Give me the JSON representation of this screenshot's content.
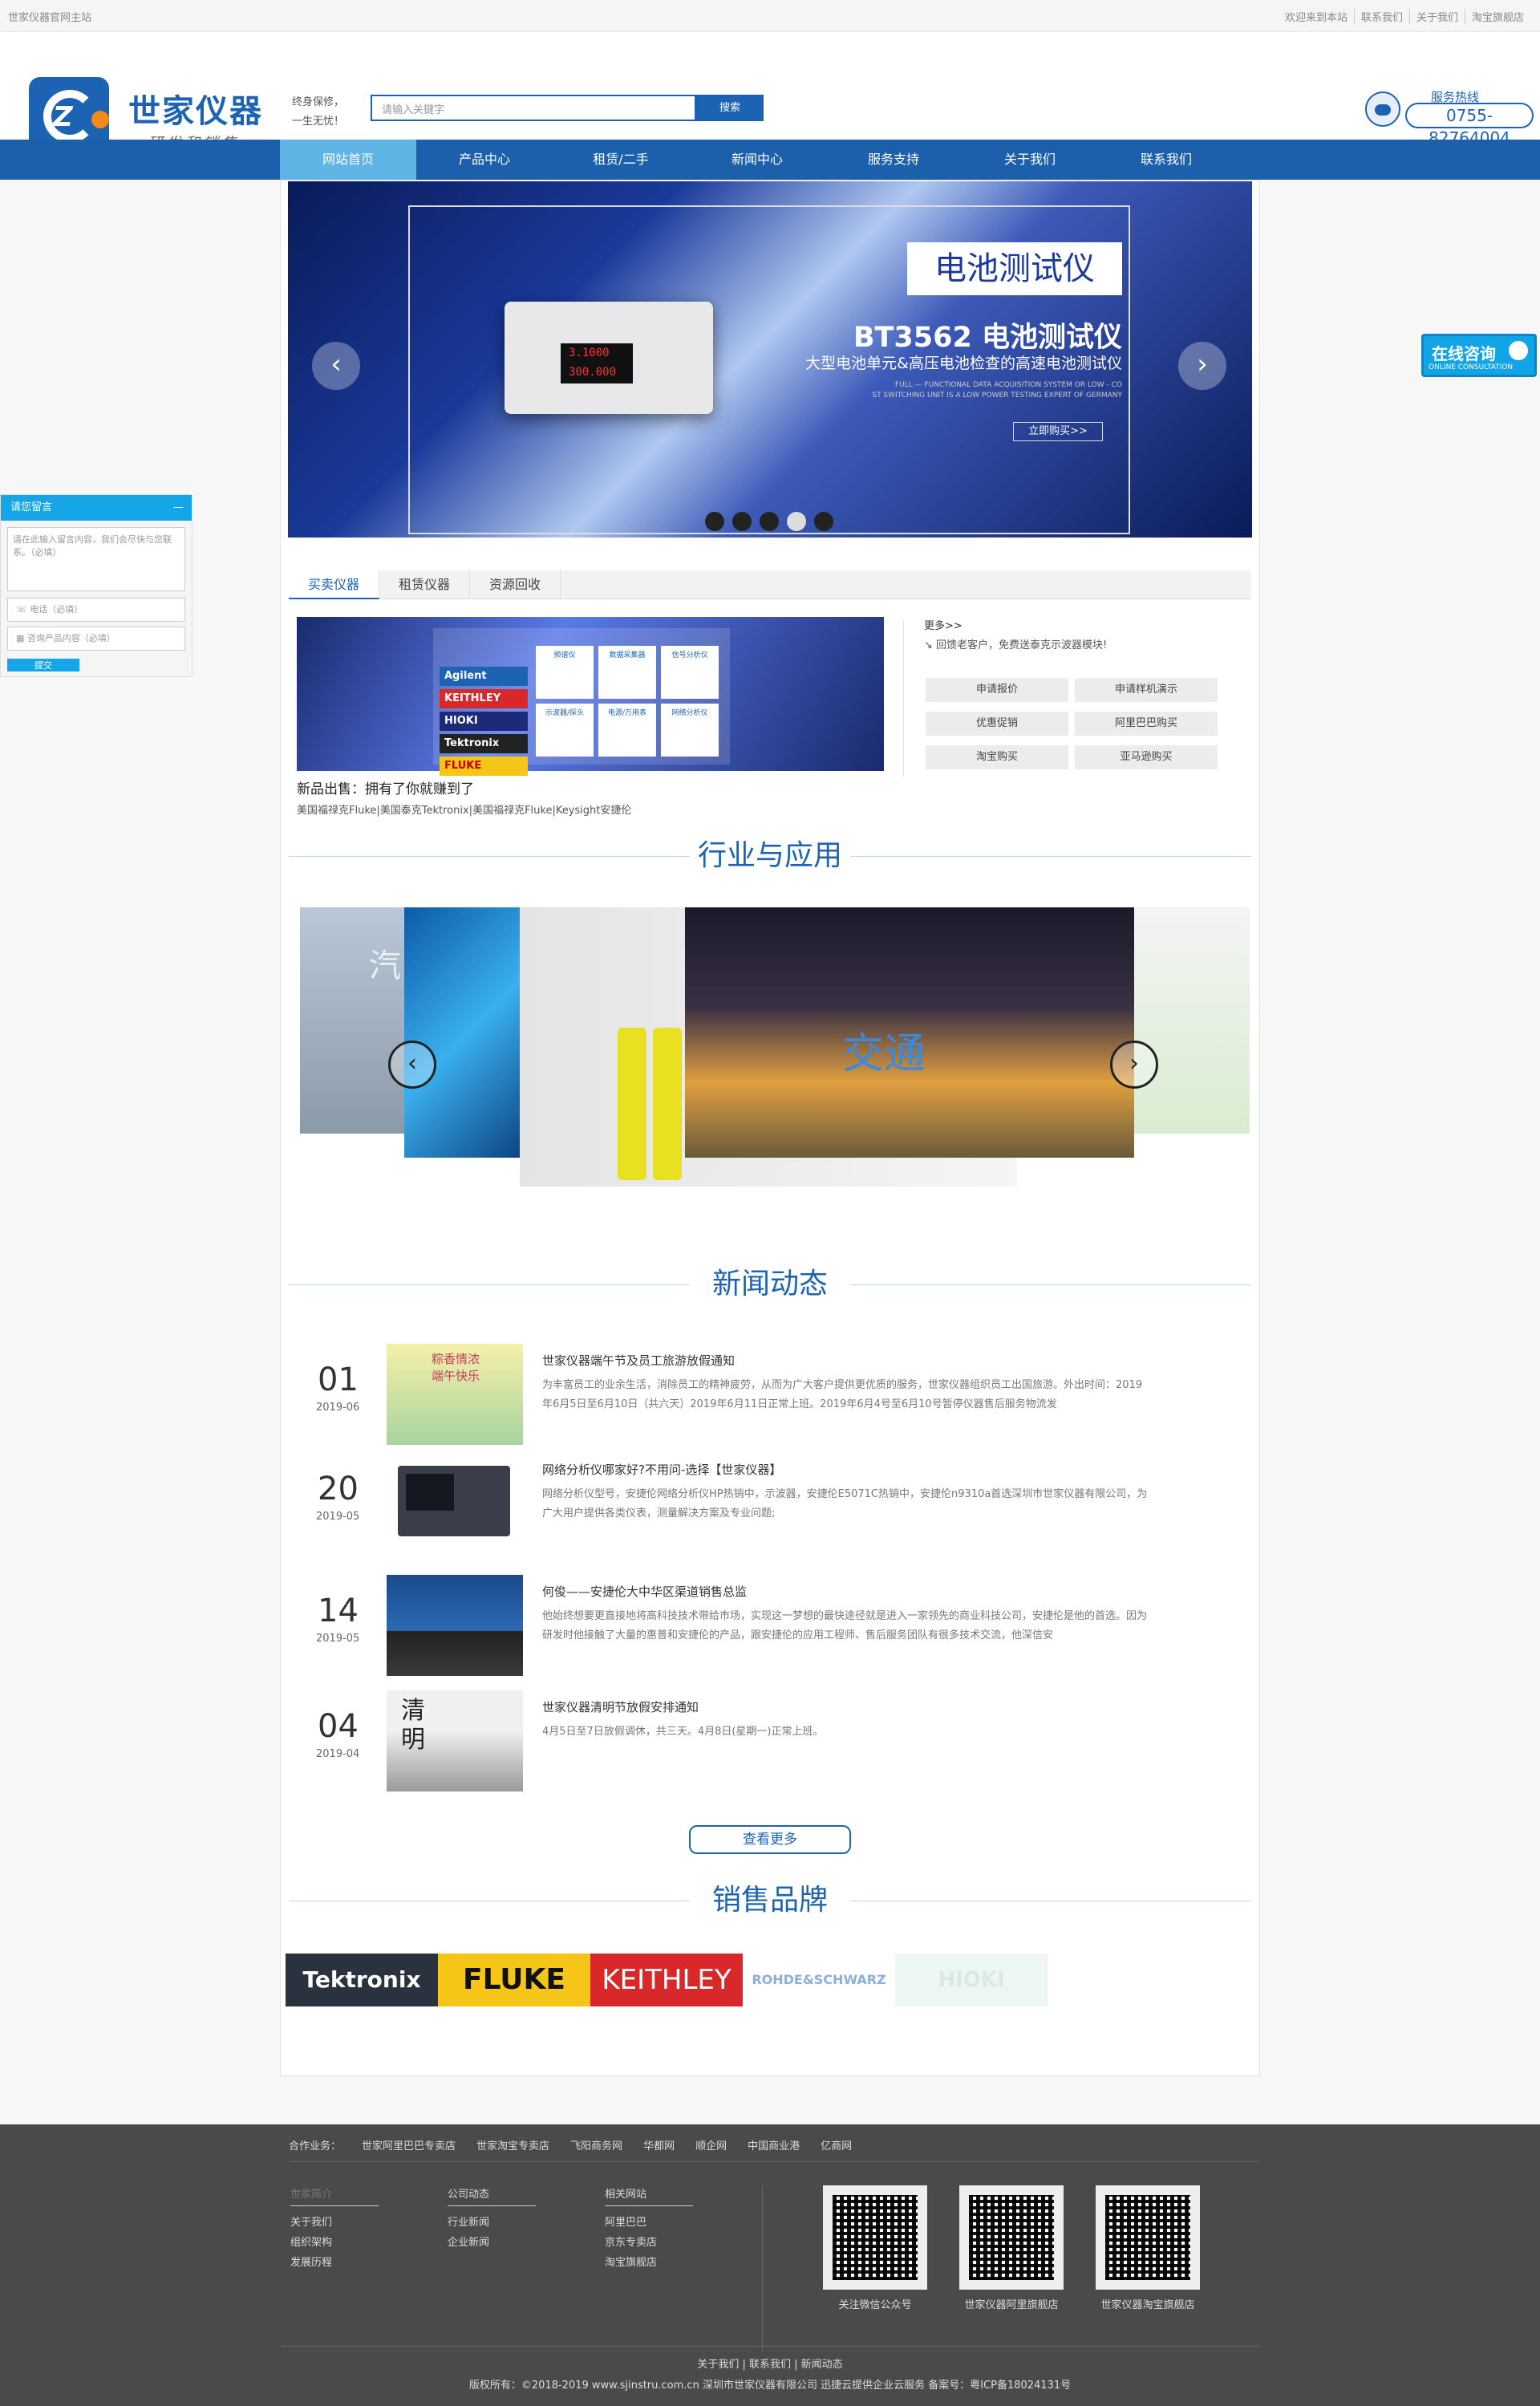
{
  "topbar": {
    "left": "世家仪器官网主站",
    "links": [
      "欢迎来到本站",
      "联系我们",
      "关于我们",
      "淘宝旗舰店"
    ]
  },
  "header": {
    "brand_name": "世家仪器",
    "brand_slogan": "研发和销售",
    "tagline_1": "终身保修，",
    "tagline_2": "一生无忧！",
    "search_placeholder": "请输入关键字",
    "search_button": "搜索",
    "hotline_label": "服务热线",
    "hotline_number": "0755-82764004"
  },
  "nav": [
    "网站首页",
    "产品中心",
    "租赁/二手",
    "新闻中心",
    "服务支持",
    "关于我们",
    "联系我们"
  ],
  "banner": {
    "title_box": "电池测试仪",
    "title": "BT3562 电池测试仪",
    "subtitle": "大型电池单元&高压电池检查的高速电池测试仪",
    "small_1": "FULL — FUNCTIONAL DATA ACQUISITION SYSTEM OR LOW - CO",
    "small_2": "ST SWITCHING UNIT IS A LOW POWER TESTING EXPERT OF GERMANY",
    "buy": "立即购买>>",
    "screen_1": "3.1000",
    "screen_2": "300.000",
    "slide_count": 5,
    "active_slide": 4
  },
  "tabs": [
    "买卖仪器",
    "租赁仪器",
    "资源回收"
  ],
  "product": {
    "brands": [
      "Agilent",
      "KEITHLEY",
      "HIOKI",
      "Tektronix",
      "FLUKE"
    ],
    "tiles": [
      "频谱仪",
      "数据采集器",
      "信号分析仪",
      "示波器/探头",
      "电源/万用表",
      "网络分析仪"
    ],
    "title": "新品出售：拥有了你就赚到了",
    "subtitle": "美国福禄克Fluke|美国泰克Tektronix|美国福禄克Fluke|Keysight安捷伦"
  },
  "side": {
    "more": "更多>>",
    "notice": "回馈老客户，免费送泰克示波器模块!",
    "buttons": [
      "申请报价",
      "申请样机演示",
      "优惠促销",
      "阿里巴巴购买",
      "淘宝购买",
      "亚马逊购买"
    ]
  },
  "sections": {
    "industry": "行业与应用",
    "news": "新闻动态",
    "brands": "销售品牌"
  },
  "carousel": {
    "left_label": "汽",
    "center_label": "交通"
  },
  "news": [
    {
      "day": "01",
      "month": "2019-06",
      "title": "世家仪器端午节及员工旅游放假通知",
      "body": "为丰富员工的业余生活，消除员工的精神疲劳，从而为广大客户提供更优质的服务，世家仪器组织员工出国旅游。外出时间：2019年6月5日至6月10日（共六天）2019年6月11日正常上班。2019年6月4号至6月10号暂停仪器售后服务物流发"
    },
    {
      "day": "20",
      "month": "2019-05",
      "title": "网络分析仪哪家好?不用问-选择【世家仪器】",
      "body": "网络分析仪型号，安捷伦网络分析仪HP热销中，示波器，安捷伦E5071C热销中，安捷伦n9310a首选深圳市世家仪器有限公司，为广大用户提供各类仪表，测量解决方案及专业问题;"
    },
    {
      "day": "14",
      "month": "2019-05",
      "title": "何俊——安捷伦大中华区渠道销售总监",
      "body": "他始终想要更直接地将高科技技术带给市场，实现这一梦想的最快途径就是进入一家领先的商业科技公司，安捷伦是他的首选。因为研发时他接触了大量的惠普和安捷伦的产品，跟安捷伦的应用工程师、售后服务团队有很多技术交流，他深信安"
    },
    {
      "day": "04",
      "month": "2019-04",
      "title": "世家仪器清明节放假安排通知",
      "body": "4月5日至7日放假调休，共三天。4月8日(星期一)正常上班。"
    }
  ],
  "news_thumb_text": [
    "粽香情浓 端午快乐",
    "清明"
  ],
  "view_more": "查看更多",
  "brand_logos": [
    "Tektronix",
    "FLUKE",
    "KEITHLEY",
    "ROHDE&SCHWARZ",
    "HIOKI"
  ],
  "left_panel": {
    "title": "请您留言",
    "min": "—",
    "message_placeholder": "请在此输入留言内容，我们会尽快与您联系。（必填）",
    "phone_placeholder": "电话（必填）",
    "product_placeholder": "咨询产品内容（必填）",
    "submit": "提交"
  },
  "consult": {
    "title": "在线咨询",
    "sub": "ONLINE CONSULTATION"
  },
  "footer": {
    "partner_label": "合作业务：",
    "partners": [
      "世家阿里巴巴专卖店",
      "世家淘宝专卖店",
      "飞阳商务网",
      "华都网",
      "顺企网",
      "中国商业港",
      "亿商网"
    ],
    "cols": [
      {
        "head": "世家简介",
        "items": [
          "关于我们",
          "组织架构",
          "发展历程"
        ]
      },
      {
        "head": "公司动态",
        "items": [
          "行业新闻",
          "企业新闻"
        ]
      },
      {
        "head": "相关网站",
        "items": [
          "阿里巴巴",
          "京东专卖店",
          "淘宝旗舰店"
        ]
      }
    ],
    "qr": [
      "关注微信公众号",
      "世家仪器阿里旗舰店",
      "世家仪器淘宝旗舰店"
    ],
    "bottom_links": "关于我们 | 联系我们 | 新闻动态",
    "copyright": "版权所有：©2018-2019 www.sjinstru.com.cn 深圳市世家仪器有限公司  迅捷云提供企业云服务  备案号：粤ICP备18024131号"
  }
}
